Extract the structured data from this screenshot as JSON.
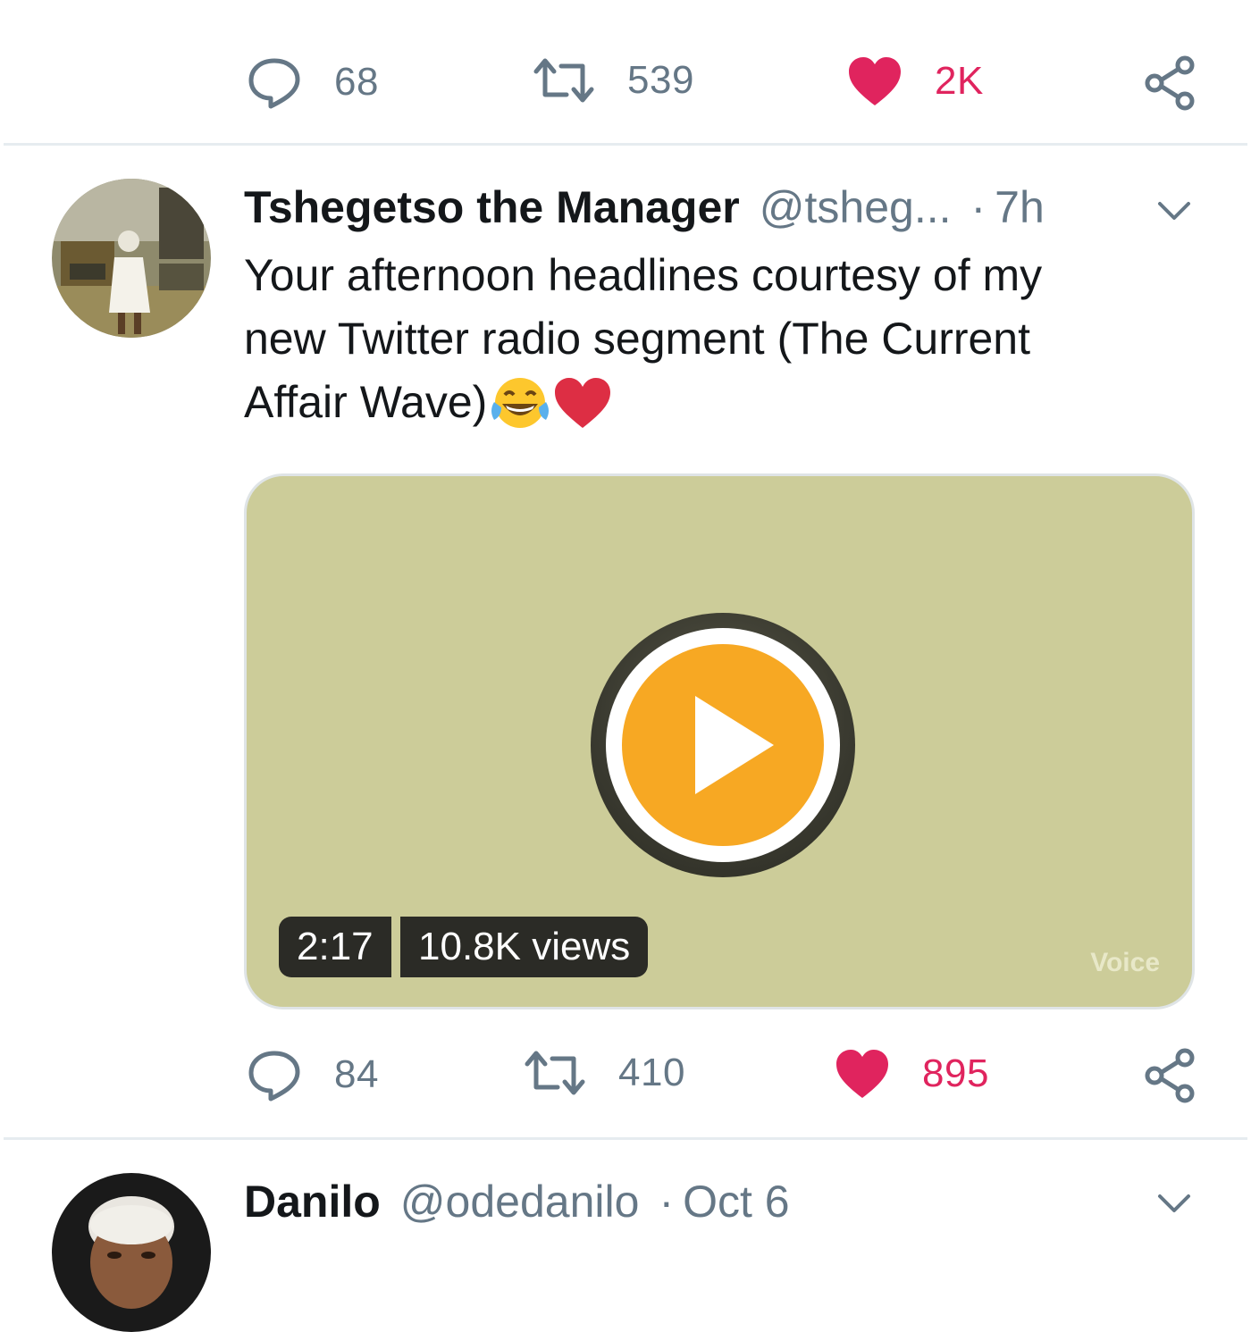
{
  "tweet_prev": {
    "reply_count": "68",
    "retweet_count": "539",
    "like_count": "2K"
  },
  "tweet_main": {
    "display_name": "Tshegetso the Manager",
    "handle": "@tsheg...",
    "separator": "·",
    "time": "7h",
    "text_line1": "Your afternoon headlines courtesy of my",
    "text_line2": "new Twitter radio segment (The Current",
    "text_line3": "Affair Wave)",
    "emoji": "😂❤",
    "media": {
      "duration": "2:17",
      "views": "10.8K views",
      "watermark": "Voice"
    },
    "reply_count": "84",
    "retweet_count": "410",
    "like_count": "895"
  },
  "tweet_next": {
    "display_name": "Danilo",
    "handle": "@odedanilo",
    "separator": "·",
    "time": "Oct 6"
  },
  "colors": {
    "like": "#e0245e",
    "muted": "#657786",
    "media_bg": "#cccc99",
    "play": "#f7a823"
  }
}
